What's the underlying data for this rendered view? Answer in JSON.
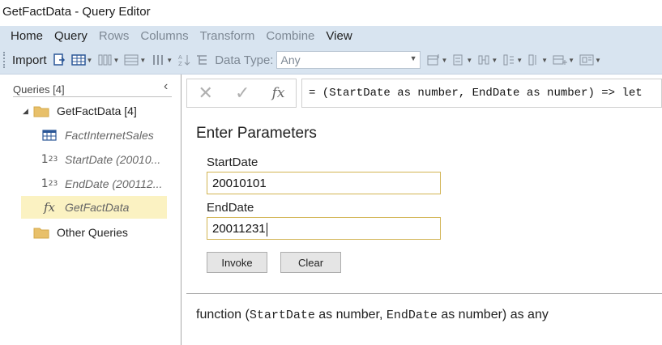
{
  "window": {
    "title": "GetFactData - Query Editor"
  },
  "menu": [
    {
      "label": "Home",
      "enabled": true
    },
    {
      "label": "Query",
      "enabled": true
    },
    {
      "label": "Rows",
      "enabled": false
    },
    {
      "label": "Columns",
      "enabled": false
    },
    {
      "label": "Transform",
      "enabled": false
    },
    {
      "label": "Combine",
      "enabled": false
    },
    {
      "label": "View",
      "enabled": true
    }
  ],
  "toolbar": {
    "import_label": "Import",
    "data_type_label": "Data Type:",
    "data_type_value": "Any"
  },
  "sidebar": {
    "header": "Queries [4]",
    "items": [
      {
        "label": "GetFactData [4]",
        "type": "folder"
      },
      {
        "label": "FactInternetSales",
        "type": "table"
      },
      {
        "label": "StartDate (20010...",
        "type": "number"
      },
      {
        "label": "EndDate (200112...",
        "type": "number"
      },
      {
        "label": "GetFactData",
        "type": "function",
        "selected": true
      },
      {
        "label": "Other Queries",
        "type": "folder"
      }
    ]
  },
  "formula": {
    "cancel_symbol": "✕",
    "commit_symbol": "✓",
    "fx_symbol": "fx",
    "text": "= (StartDate as number, EndDate as number) => let"
  },
  "params": {
    "title": "Enter Parameters",
    "start_label": "StartDate",
    "start_value": "20010101",
    "end_label": "EndDate",
    "end_value": "20011231",
    "invoke_label": "Invoke",
    "clear_label": "Clear"
  },
  "signature": {
    "prefix": "function (",
    "param1": "StartDate",
    "mid1": " as number, ",
    "param2": "EndDate",
    "suffix": " as number) as any"
  },
  "colors": {
    "ribbon": "#d8e4f0",
    "selected_row": "#fbf2c2",
    "folder": "#e8c06a",
    "input_border": "#d2b453"
  }
}
